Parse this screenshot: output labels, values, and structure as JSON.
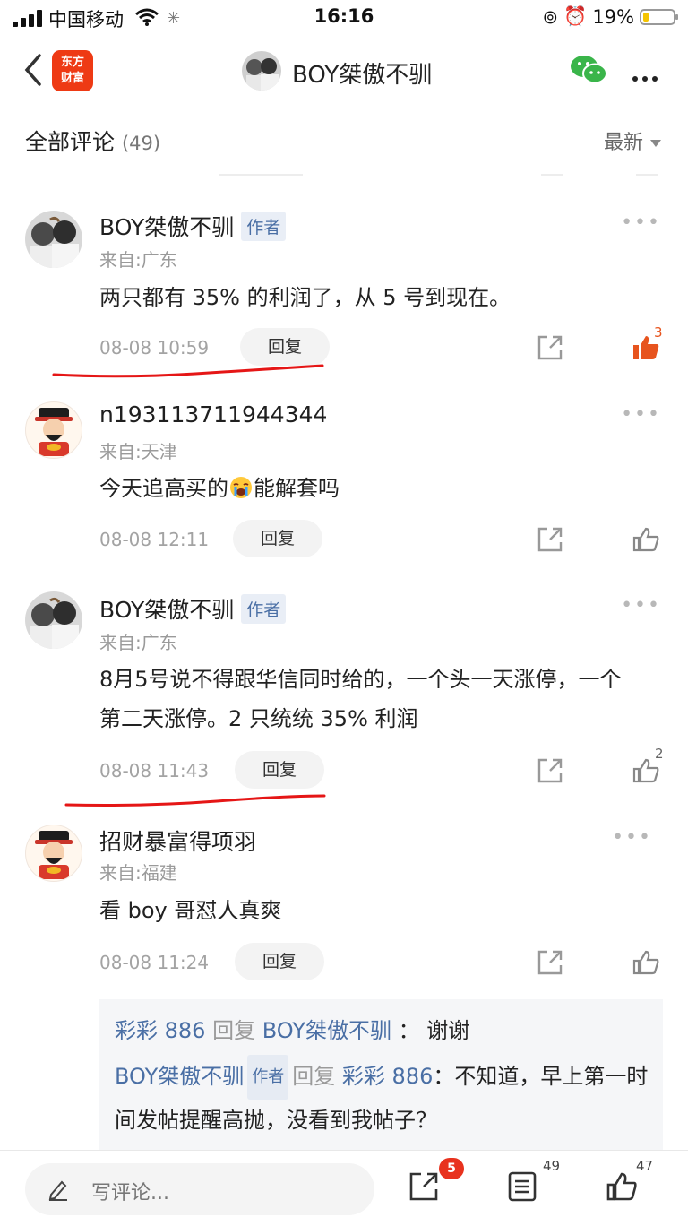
{
  "status_bar": {
    "carrier": "中国移动",
    "time": "16:16",
    "battery": "19%"
  },
  "nav": {
    "logo_line1": "东方",
    "logo_line2": "财富",
    "title": "BOY桀傲不驯"
  },
  "header": {
    "title": "全部评论",
    "count": "(49)",
    "sort": "最新"
  },
  "comments": [
    {
      "name": "BOY桀傲不驯",
      "tag": "作者",
      "from": "来自:广东",
      "text": "两只都有 35% 的利润了，从 5 号到现在。",
      "time": "08-08 10:59",
      "reply": "回复",
      "likes": "3",
      "liked": true
    },
    {
      "name": "n193113711944344",
      "from": "来自:天津",
      "text_before": "今天追高买的",
      "text_after": "能解套吗",
      "time": "08-08 12:11",
      "reply": "回复"
    },
    {
      "name": "BOY桀傲不驯",
      "tag": "作者",
      "from": "来自:广东",
      "text": "8月5号说不得跟华信同时给的，一个头一天涨停，一个第二天涨停。2 只统统 35% 利润",
      "time": "08-08 11:43",
      "reply": "回复",
      "likes": "2"
    },
    {
      "name": "招财暴富得项羽",
      "from": "来自:福建",
      "text": "看 boy 哥怼人真爽",
      "time": "08-08 11:24",
      "reply": "回复"
    }
  ],
  "nested_replies": [
    {
      "from": "彩彩 886",
      "verb": "回复",
      "to": "BOY桀傲不驯",
      "sep": "：",
      "text": "谢谢"
    },
    {
      "from": "BOY桀傲不驯",
      "tag": "作者",
      "verb": "回复",
      "to": "彩彩 886",
      "sep": "：",
      "text": "不知道，早上第一时间发帖提醒高抛，没看到我帖子？"
    }
  ],
  "bottom_bar": {
    "placeholder": "写评论...",
    "share_badge": "5",
    "comment_count": "49",
    "like_count": "47"
  },
  "colors": {
    "accent_red": "#e8321e",
    "brand_orange": "#ee3a14",
    "link_blue": "#4a6fa5",
    "like_orange": "#e7541e"
  },
  "icons": [
    "signal-icon",
    "wifi-icon",
    "battery-icon",
    "back-icon",
    "wechat-icon",
    "more-icon",
    "share-icon",
    "like-icon",
    "pen-icon",
    "comment-list-icon"
  ]
}
